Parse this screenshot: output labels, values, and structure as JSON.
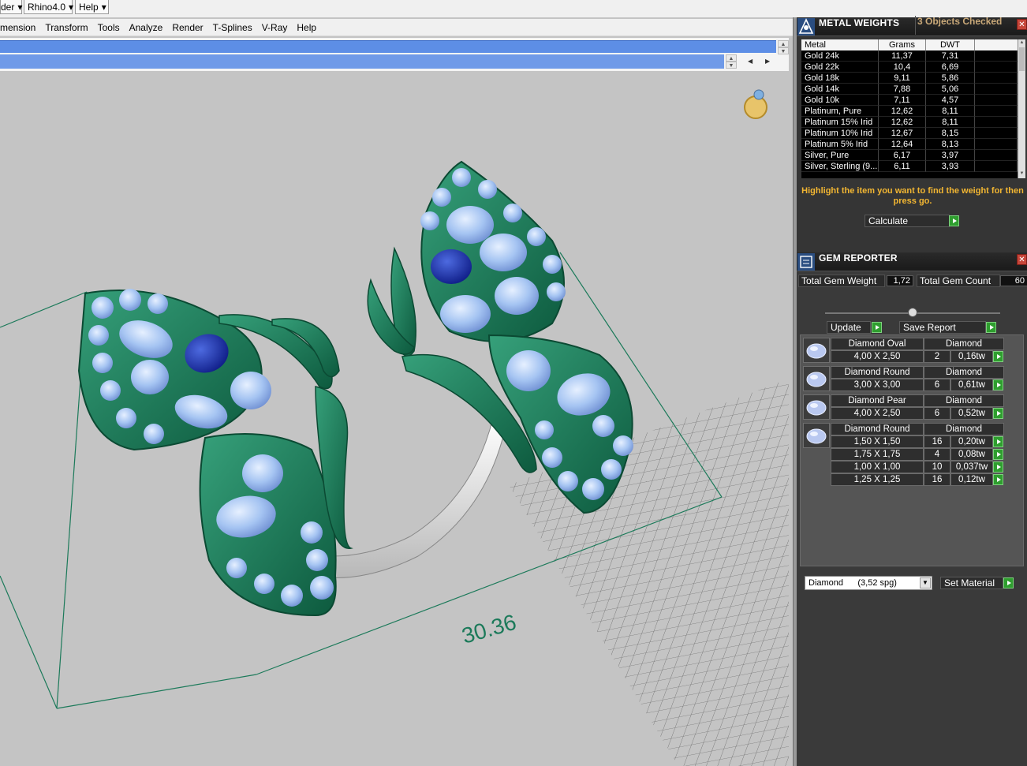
{
  "top_menus": [
    {
      "label": "der"
    },
    {
      "label": "Rhino4.0"
    },
    {
      "label": "Help"
    }
  ],
  "menubar": [
    "mension",
    "Transform",
    "Tools",
    "Analyze",
    "Render",
    "T-Splines",
    "V-Ray",
    "Help"
  ],
  "viewport": {
    "dimension_label": "30.36",
    "colors": {
      "background": "#c4c4c4",
      "metal": "#1e7a5a",
      "stone": "#a5c4f2",
      "accent_stone": "#1a2e9c",
      "band": "#f2f2f2",
      "grid": "#6c6c6c"
    }
  },
  "metal_weights": {
    "title": "METAL WEIGHTS",
    "subtitle": "3 Objects Checked",
    "columns": [
      "Metal",
      "Grams",
      "DWT"
    ],
    "rows": [
      [
        "Gold 24k",
        "11,37",
        "7,31"
      ],
      [
        "Gold 22k",
        "10,4",
        "6,69"
      ],
      [
        "Gold 18k",
        "9,11",
        "5,86"
      ],
      [
        "Gold 14k",
        "7,88",
        "5,06"
      ],
      [
        "Gold 10k",
        "7,11",
        "4,57"
      ],
      [
        "Platinum, Pure",
        "12,62",
        "8,11"
      ],
      [
        "Platinum 15% Irid",
        "12,62",
        "8,11"
      ],
      [
        "Platinum 10% Irid",
        "12,67",
        "8,15"
      ],
      [
        "Platinum 5% Irid",
        "12,64",
        "8,13"
      ],
      [
        "Silver, Pure",
        "6,17",
        "3,97"
      ],
      [
        "Silver, Sterling (9...",
        "6,11",
        "3,93"
      ]
    ],
    "hint": "Highlight the item you want to find the weight for then press go.",
    "calculate_label": "Calculate"
  },
  "gem_reporter": {
    "title": "GEM REPORTER",
    "total_weight_label": "Total Gem Weight",
    "total_weight_value": "1,72",
    "total_count_label": "Total Gem Count",
    "total_count_value": "60",
    "update_label": "Update",
    "save_label": "Save Report",
    "groups": [
      {
        "shape": "Diamond Oval",
        "material": "Diamond",
        "rows": [
          [
            "4,00 X 2,50",
            "2",
            "0,16tw"
          ]
        ]
      },
      {
        "shape": "Diamond Round",
        "material": "Diamond",
        "rows": [
          [
            "3,00 X 3,00",
            "6",
            "0,61tw"
          ]
        ]
      },
      {
        "shape": "Diamond Pear",
        "material": "Diamond",
        "rows": [
          [
            "4,00 X 2,50",
            "6",
            "0,52tw"
          ]
        ]
      },
      {
        "shape": "Diamond Round",
        "material": "Diamond",
        "rows": [
          [
            "1,50 X 1,50",
            "16",
            "0,20tw"
          ],
          [
            "1,75 X 1,75",
            "4",
            "0,08tw"
          ],
          [
            "1,00 X 1,00",
            "10",
            "0,037tw"
          ],
          [
            "1,25 X 1,25",
            "16",
            "0,12tw"
          ]
        ]
      }
    ],
    "material_select": "Diamond      (3,52 spg)",
    "set_material_label": "Set Material"
  }
}
